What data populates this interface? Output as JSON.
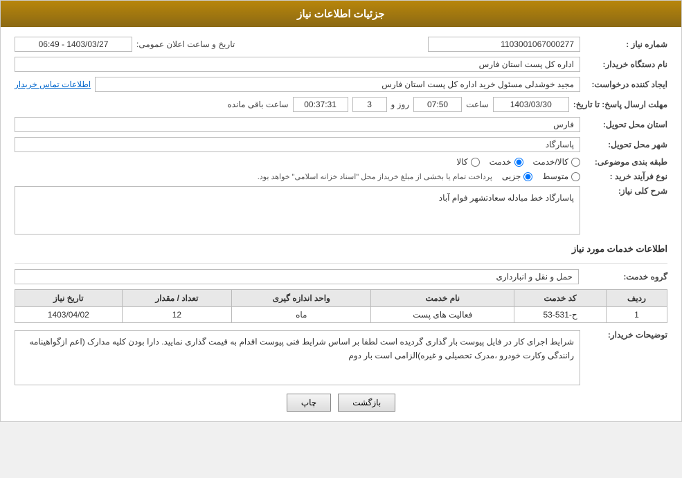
{
  "header": {
    "title": "جزئیات اطلاعات نیاز"
  },
  "fields": {
    "need_number_label": "شماره نیاز :",
    "need_number_value": "1103001067000277",
    "buyer_org_label": "نام دستگاه خریدار:",
    "buyer_org_value": "اداره کل پست استان فارس",
    "requester_label": "ایجاد کننده درخواست:",
    "requester_value": "مجید خوشدلی مسئول خرید اداره کل پست استان فارس",
    "requester_link": "اطلاعات تماس خریدار",
    "announce_date_label": "تاریخ و ساعت اعلان عمومی:",
    "announce_date_value": "1403/03/27 - 06:49",
    "response_deadline_label": "مهلت ارسال پاسخ: تا تاریخ:",
    "response_date": "1403/03/30",
    "response_time_label": "ساعت",
    "response_time": "07:50",
    "response_days_label": "روز و",
    "response_days": "3",
    "response_remaining_label": "ساعت باقی مانده",
    "response_remaining": "00:37:31",
    "province_label": "استان محل تحویل:",
    "province_value": "فارس",
    "city_label": "شهر محل تحویل:",
    "city_value": "پاسارگاد",
    "category_label": "طبقه بندی موضوعی:",
    "category_options": [
      "کالا",
      "خدمت",
      "کالا/خدمت"
    ],
    "category_selected": "خدمت",
    "purchase_type_label": "نوع فرآیند خرید :",
    "purchase_type_options": [
      "جزیی",
      "متوسط"
    ],
    "purchase_type_note": "پرداخت تمام یا بخشی از مبلغ خریداز محل \"اسناد خزانه اسلامی\" خواهد بود.",
    "need_desc_label": "شرح کلی نیاز:",
    "need_desc_value": "پاسارگاد خط مبادله سعادتشهر فوام آباد",
    "service_info_title": "اطلاعات خدمات مورد نیاز",
    "service_group_label": "گروه خدمت:",
    "service_group_value": "حمل و نقل و انبارداری",
    "table": {
      "columns": [
        "ردیف",
        "کد خدمت",
        "نام خدمت",
        "واحد اندازه گیری",
        "تعداد / مقدار",
        "تاریخ نیاز"
      ],
      "rows": [
        {
          "row_num": "1",
          "service_code": "ح-531-53",
          "service_name": "فعالیت های پست",
          "unit": "ماه",
          "quantity": "12",
          "date": "1403/04/02"
        }
      ]
    },
    "buyer_desc_label": "توضیحات خریدار:",
    "buyer_desc_value": "شرایط اجرای کار در فایل پیوست بار گذاری گردیده است لطفا بر اساس شرایط فنی پیوست اقدام به قیمت گذاری نمایید.\nدارا بودن کلیه مدارک (اعم ازگواهینامه رانندگی وکارت خودرو ،مدرک تحصیلی و غیره)الزامی است\nبار دوم"
  },
  "buttons": {
    "back_label": "بازگشت",
    "print_label": "چاپ"
  }
}
